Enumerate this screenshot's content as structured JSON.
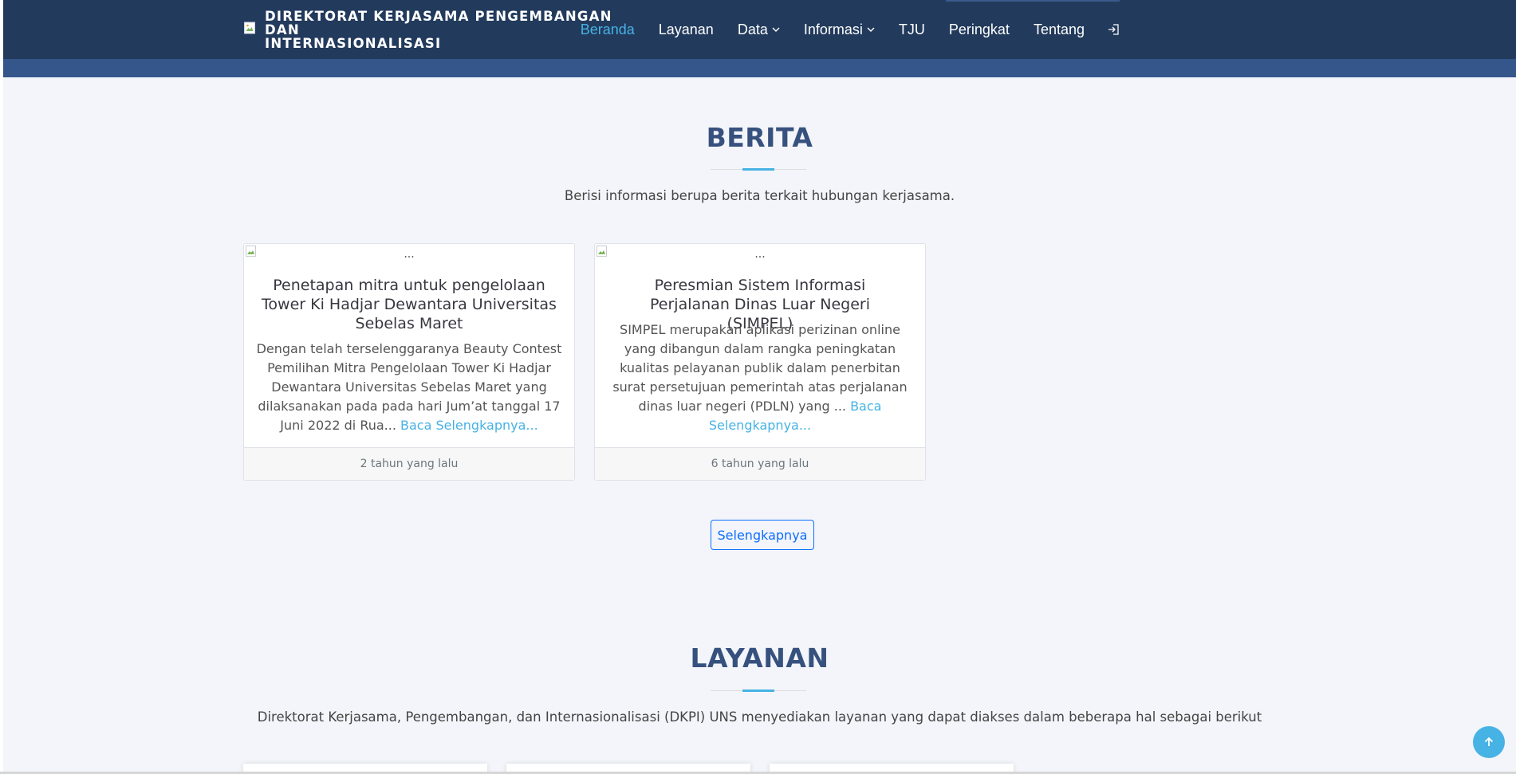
{
  "header": {
    "brand_line1": "DIREKTORAT KERJASAMA PENGEMBANGAN DAN",
    "brand_line2": "INTERNASIONALISASI",
    "nav": [
      {
        "label": "Beranda",
        "active": true
      },
      {
        "label": "Layanan"
      },
      {
        "label": "Data",
        "dropdown": true
      },
      {
        "label": "Informasi",
        "dropdown": true
      },
      {
        "label": "TJU"
      },
      {
        "label": "Peringkat"
      },
      {
        "label": "Tentang"
      }
    ],
    "login_icon": "sign-in-icon"
  },
  "berita": {
    "title": "BERITA",
    "description": "Berisi informasi berupa berita terkait hubungan kerjasama.",
    "cards": [
      {
        "image_alt": "...",
        "title": "Penetapan mitra untuk pengelolaan Tower Ki Hadjar Dewantara Universitas Sebelas Maret",
        "excerpt": "Dengan telah terselenggaranya Beauty Contest Pemilihan Mitra Pengelolaan Tower Ki Hadjar Dewantara  Universitas Sebelas Maret yang dilaksanakan pada pada hari Jum’at tanggal 17 Juni 2022 di Rua... ",
        "read_more": "Baca Selengkapnya...",
        "footer": "2 tahun yang lalu"
      },
      {
        "image_alt": "...",
        "title": "Peresmian Sistem Informasi Perjalanan Dinas Luar Negeri (SIMPEL)",
        "excerpt": "SIMPEL merupakan aplikasi perizinan online yang dibangun dalam rangka peningkatan kualitas pelayanan publik dalam penerbitan surat persetujuan pemerintah atas perjalanan dinas luar negeri (PDLN) yang ... ",
        "read_more": "Baca Selengkapnya...",
        "footer": "6 tahun yang lalu"
      }
    ],
    "more_button": "Selengkapnya"
  },
  "layanan": {
    "title": "LAYANAN",
    "description": "Direktorat Kerjasama, Pengembangan, dan Internasionalisasi (DKPI) UNS menyediakan layanan yang dapat diakses dalam beberapa hal sebagai berikut"
  },
  "colors": {
    "header_bg": "#223a5c",
    "header_strip": "#34568b",
    "accent": "#47b2e4",
    "title": "#37517e",
    "button": "#0d6efd"
  },
  "back_to_top_icon": "arrow-up-icon"
}
